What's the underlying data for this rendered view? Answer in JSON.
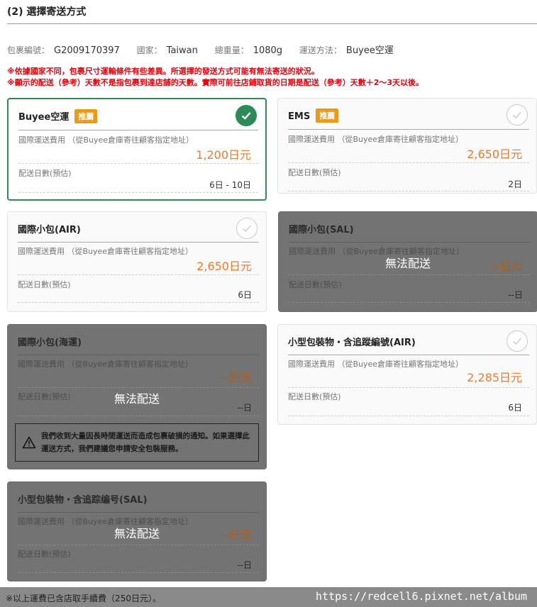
{
  "section": {
    "title": "(2) 選擇寄送方式"
  },
  "package": {
    "id_label": "包裹編號：",
    "id_value": "G2009170397",
    "country_label": "國家：",
    "country_value": "Taiwan",
    "weight_label": "總重量：",
    "weight_value": "1080g",
    "method_label": "運送方法：",
    "method_value": "Buyee空運"
  },
  "notices": [
    "※依據國家不同，包裹尺寸運輸條件有些差異。所選擇的發送方式可能有無法寄送的狀況。",
    "※顯示的配送（參考）天數不是指包裹到達店舖的天數。實際可前往店鋪取貨的日期是配送（參考）天數＋2～3天以後。"
  ],
  "options": [
    {
      "name": "Buyee空運",
      "badge": "推薦",
      "fee_label": "國際運送費用 （從Buyee倉庫寄往顧客指定地址）",
      "fee": "1,200日元",
      "days_label": "配送日數(預估)",
      "days": "6日 - 10日",
      "state": "selected"
    },
    {
      "name": "EMS",
      "badge": "推薦",
      "fee_label": "國際運送費用 （從Buyee倉庫寄往顧客指定地址）",
      "fee": "2,650日元",
      "days_label": "配送日數(預估)",
      "days": "2日",
      "state": "available"
    },
    {
      "name": "國際小包(AIR)",
      "badge": "",
      "fee_label": "國際運送費用 （從Buyee倉庫寄往顧客指定地址）",
      "fee": "2,650日元",
      "days_label": "配送日數(預估)",
      "days": "6日",
      "state": "available"
    },
    {
      "name": "國際小包(SAL)",
      "badge": "",
      "fee_label": "國際運送費用 （從Buyee倉庫寄往顧客指定地址）",
      "fee": "--日元",
      "days_label": "配送日數(預估)",
      "days": "--日",
      "state": "unavailable",
      "unavailable_text": "無法配送"
    },
    {
      "name": "國際小包(海運)",
      "badge": "",
      "fee_label": "國際運送費用 （從Buyee倉庫寄往顧客指定地址）",
      "fee": "--日元",
      "days_label": "配送日數(預估)",
      "days": "--日",
      "state": "unavailable",
      "unavailable_text": "無法配送",
      "warning": "我們收到大量因長時間運送而造成包裹破損的通知。如果選擇此運送方式，我們建議您申請安全包裝服務。"
    },
    {
      "name": "小型包裝物・含追蹤編號(AIR)",
      "badge": "",
      "fee_label": "國際運送費用 （從Buyee倉庫寄往顧客指定地址）",
      "fee": "2,285日元",
      "days_label": "配送日數(預估)",
      "days": "6日",
      "state": "available"
    },
    {
      "name": "小型包裝物・含追踪编号(SAL)",
      "badge": "",
      "fee_label": "國際運送費用 （從Buyee倉庫寄往顧客指定地址）",
      "fee": "--日元",
      "days_label": "配送日數(預估)",
      "days": "--日",
      "state": "unavailable",
      "unavailable_text": "無法配送"
    }
  ],
  "footer": {
    "note": "※以上運費已含店取手續費（250日元）。",
    "watermark": "https://redcell6.pixnet.net/album"
  },
  "colors": {
    "accent": "#2e8b57",
    "badge": "#ea9a17",
    "price": "#f07a2a",
    "notice": "#e8000b",
    "disabled": "#737373"
  }
}
